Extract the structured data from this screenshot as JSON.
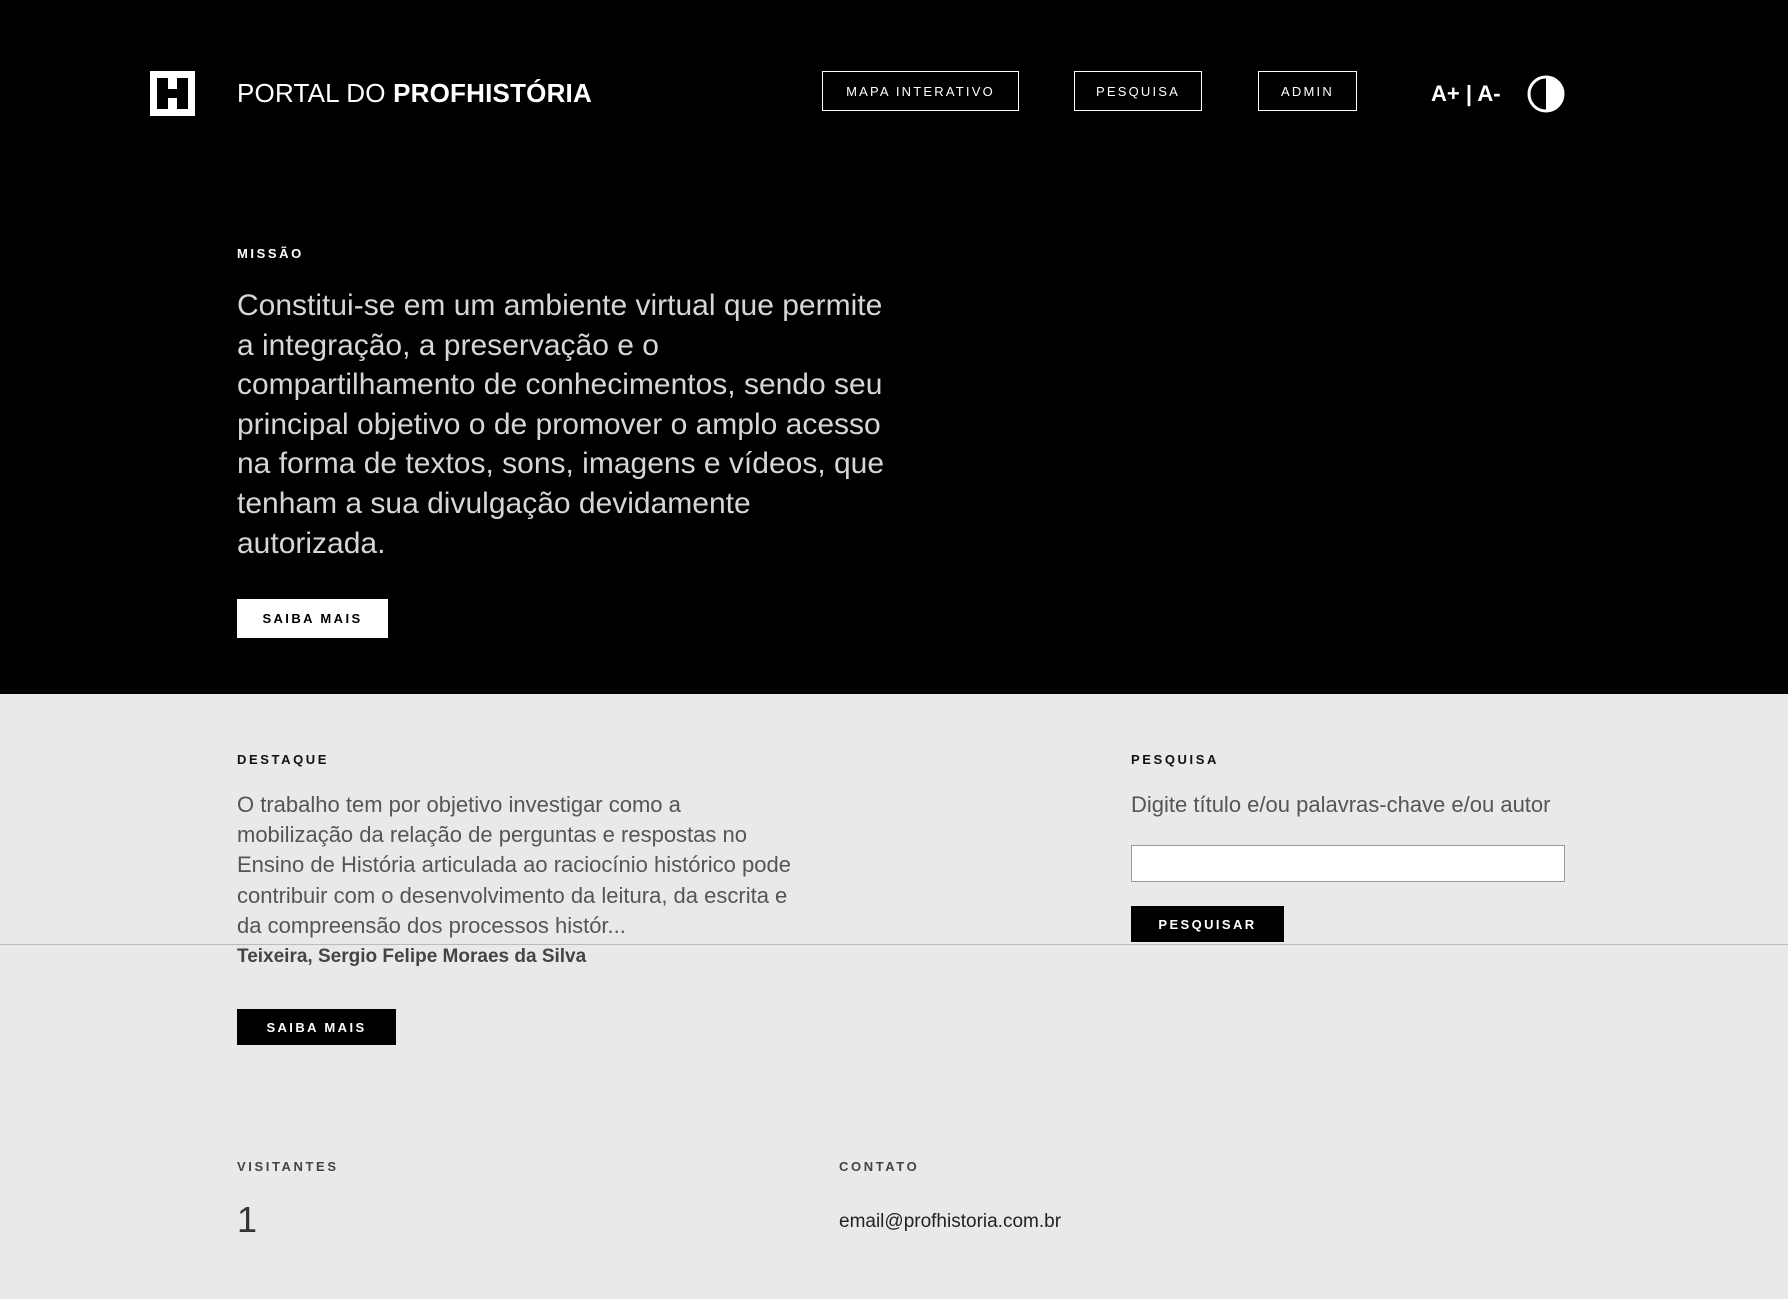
{
  "header": {
    "brand_light": "PORTAL DO ",
    "brand_bold": "PROFHISTÓRIA",
    "logo_letter": "H",
    "nav": {
      "mapa": "MAPA INTERATIVO",
      "pesquisa": "PESQUISA",
      "admin": "ADMIN"
    },
    "font_increase": "A+",
    "font_separator": " | ",
    "font_decrease": "A-",
    "contrast_icon": "contrast-toggle-icon"
  },
  "missao": {
    "label": "MISSÃO",
    "text": "Constitui-se em um ambiente virtual que permite a integração, a preservação e o compartilhamento de conhecimentos, sendo seu principal objetivo o de promover o amplo acesso na forma de textos, sons, imagens e vídeos, que tenham a sua divulgação devidamente autorizada.",
    "button": "SAIBA MAIS"
  },
  "destaque": {
    "label": "DESTAQUE",
    "text": "O trabalho tem por objetivo investigar como a mobilização da relação de perguntas e respostas no Ensino de História articulada ao raciocínio histórico pode contribuir com o desenvolvimento da leitura, da escrita e da compreensão dos processos histór...",
    "author": "Teixeira, Sergio Felipe Moraes da Silva",
    "button": "SAIBA MAIS"
  },
  "pesquisa": {
    "label": "PESQUISA",
    "hint": "Digite título e/ou palavras-chave e/ou autor",
    "input_value": "",
    "button": "PESQUISAR"
  },
  "visitantes": {
    "label": "VISITANTES",
    "value": "1"
  },
  "contato": {
    "label": "CONTATO",
    "email": "email@profhistoria.com.br"
  },
  "colors": {
    "hero_bg": "#000000",
    "page_bg": "#e8e9eb",
    "text_light": "#d6d6d6",
    "text_muted": "#555555"
  }
}
